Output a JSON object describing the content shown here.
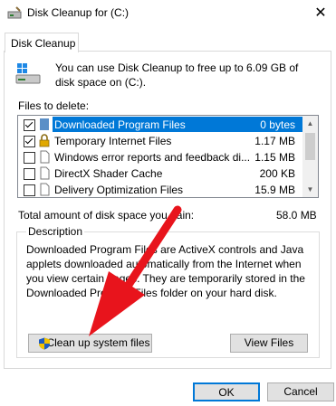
{
  "window": {
    "title": "Disk Cleanup for  (C:)",
    "close_glyph": "✕"
  },
  "tab": {
    "label": "Disk Cleanup"
  },
  "intro_text": "You can use Disk Cleanup to free up to 6.09 GB of disk space on  (C:).",
  "files_label": "Files to delete:",
  "files": [
    {
      "name": "Downloaded Program Files",
      "size": "0 bytes",
      "checked": true,
      "selected": true,
      "icon": "folder-icon"
    },
    {
      "name": "Temporary Internet Files",
      "size": "1.17 MB",
      "checked": true,
      "selected": false,
      "icon": "lock-icon"
    },
    {
      "name": "Windows error reports and feedback di...",
      "size": "1.15 MB",
      "checked": false,
      "selected": false,
      "icon": "file-icon"
    },
    {
      "name": "DirectX Shader Cache",
      "size": "200 KB",
      "checked": false,
      "selected": false,
      "icon": "file-icon"
    },
    {
      "name": "Delivery Optimization Files",
      "size": "15.9 MB",
      "checked": false,
      "selected": false,
      "icon": "file-icon"
    }
  ],
  "total": {
    "label": "Total amount of disk space you gain:",
    "value": "58.0 MB"
  },
  "description": {
    "title": "Description",
    "text": "Downloaded Program Files are ActiveX controls and Java applets downloaded automatically from the Internet when you view certain pages. They are temporarily stored in the Downloaded Program Files folder on your hard disk."
  },
  "buttons": {
    "cleanup": "Clean up system files",
    "view": "View Files",
    "ok": "OK",
    "cancel": "Cancel"
  },
  "colors": {
    "selection": "#0078d7",
    "arrow": "#e8141c"
  }
}
